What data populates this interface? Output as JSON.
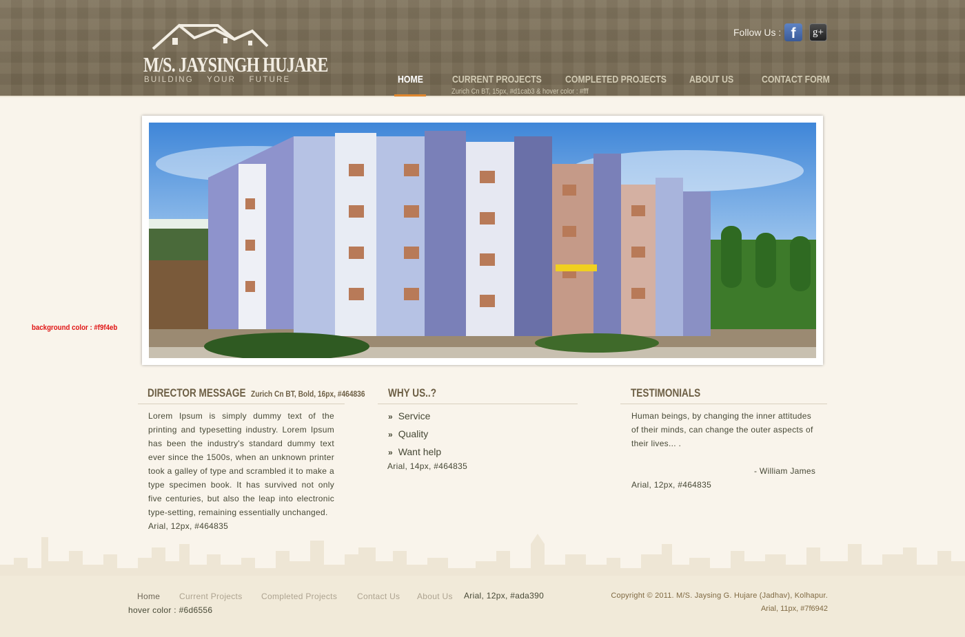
{
  "brand": {
    "name": "M/S. JAYSINGH HUJARE",
    "tagline": "BUILDING YOUR FUTURE",
    "logo_icon": "house-roof-icon"
  },
  "social": {
    "label": "Follow Us :",
    "facebook_icon": "facebook-icon",
    "facebook_glyph": "f",
    "googleplus_icon": "google-plus-icon",
    "googleplus_glyph": "g+"
  },
  "nav": {
    "items": [
      {
        "label": "HOME",
        "active": true
      },
      {
        "label": "CURRENT PROJECTS",
        "active": false
      },
      {
        "label": "COMPLETED PROJECTS",
        "active": false
      },
      {
        "label": "ABOUT US",
        "active": false
      },
      {
        "label": "CONTACT FORM",
        "active": false
      }
    ],
    "style_note": "Zurich Cn BT, 15px, #d1cab3 & hover color : #fff"
  },
  "page_note": "background color : #f9f4eb",
  "director": {
    "title": "DIRECTOR MESSAGE",
    "title_note": "Zurich Cn BT, Bold, 16px, #464836",
    "body": "Lorem Ipsum is simply dummy text of the printing and typesetting industry. Lorem Ipsum has been the industry's standard dummy text ever since the 1500s, when an unknown printer took a galley of type and scrambled it to make a type specimen book. It has survived not only five centuries, but also the leap into electronic type-setting, remaining essentially unchanged.",
    "body_note": "Arial, 12px, #464835"
  },
  "why": {
    "title": "WHY US..?",
    "items": [
      "Service",
      "Quality",
      "Want help"
    ],
    "bullet": "»",
    "note": "Arial, 14px, #464835"
  },
  "testimonials": {
    "title": "TESTIMONIALS",
    "quote": "Human beings, by changing the inner attitudes of their minds, can change the outer aspects of their lives... .",
    "author": "- William James",
    "note": "Arial, 12px, #464835"
  },
  "footer": {
    "links": [
      "Home",
      "Current Projects",
      "Completed Projects",
      "Contact Us",
      "About Us"
    ],
    "links_note": "Arial, 12px, #ada390",
    "hover_note": "hover color : #6d6556",
    "copyright": "Copyright © 2011. M/S. Jaysing G. Hujare (Jadhav), Kolhapur.",
    "copyright_note": "Arial, 11px, #7f6942"
  },
  "colors": {
    "page_bg": "#f9f4eb",
    "header_bg": "#7a6d55",
    "nav_text": "#d1cab3",
    "nav_active": "#ffffff",
    "nav_underline": "#e0862d",
    "body_text": "#464835",
    "heading": "#6d5f45",
    "footer_link": "#ada390",
    "copyright": "#7f6942",
    "annotation_red": "#e01414"
  }
}
